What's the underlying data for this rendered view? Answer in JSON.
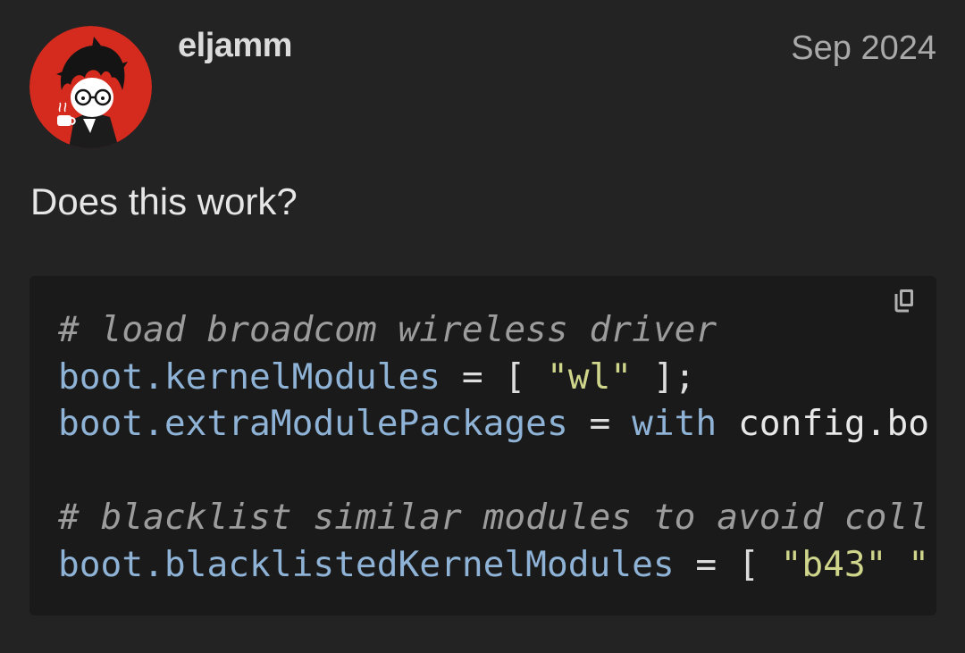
{
  "post": {
    "username": "eljamm",
    "date": "Sep 2024",
    "body_text": "Does this work?"
  },
  "avatar": {
    "description_icon": "user-avatar-icon",
    "background_color": "#d42b1e"
  },
  "code_block": {
    "copy_icon": "copy-icon",
    "lines": [
      [
        {
          "t": "# load broadcom wireless driver",
          "c": "comment"
        }
      ],
      [
        {
          "t": "boot.kernelModules",
          "c": "attr"
        },
        {
          "t": " = [ ",
          "c": "op"
        },
        {
          "t": "\"wl\"",
          "c": "str"
        },
        {
          "t": " ];",
          "c": "op"
        }
      ],
      [
        {
          "t": "boot.extraModulePackages",
          "c": "attr"
        },
        {
          "t": " = ",
          "c": "op"
        },
        {
          "t": "with",
          "c": "kw"
        },
        {
          "t": " config.bo",
          "c": "plain"
        }
      ],
      [
        {
          "t": " ",
          "c": "plain"
        }
      ],
      [
        {
          "t": "# blacklist similar modules to avoid coll",
          "c": "comment"
        }
      ],
      [
        {
          "t": "boot.blacklistedKernelModules",
          "c": "attr"
        },
        {
          "t": " = [ ",
          "c": "op"
        },
        {
          "t": "\"b43\"",
          "c": "str"
        },
        {
          "t": " \"",
          "c": "str"
        }
      ]
    ]
  },
  "colors": {
    "background": "#232323",
    "code_background": "#1a1a1a",
    "comment": "#9c9c9c",
    "attribute": "#8fb3d6",
    "string": "#cfd58a"
  }
}
